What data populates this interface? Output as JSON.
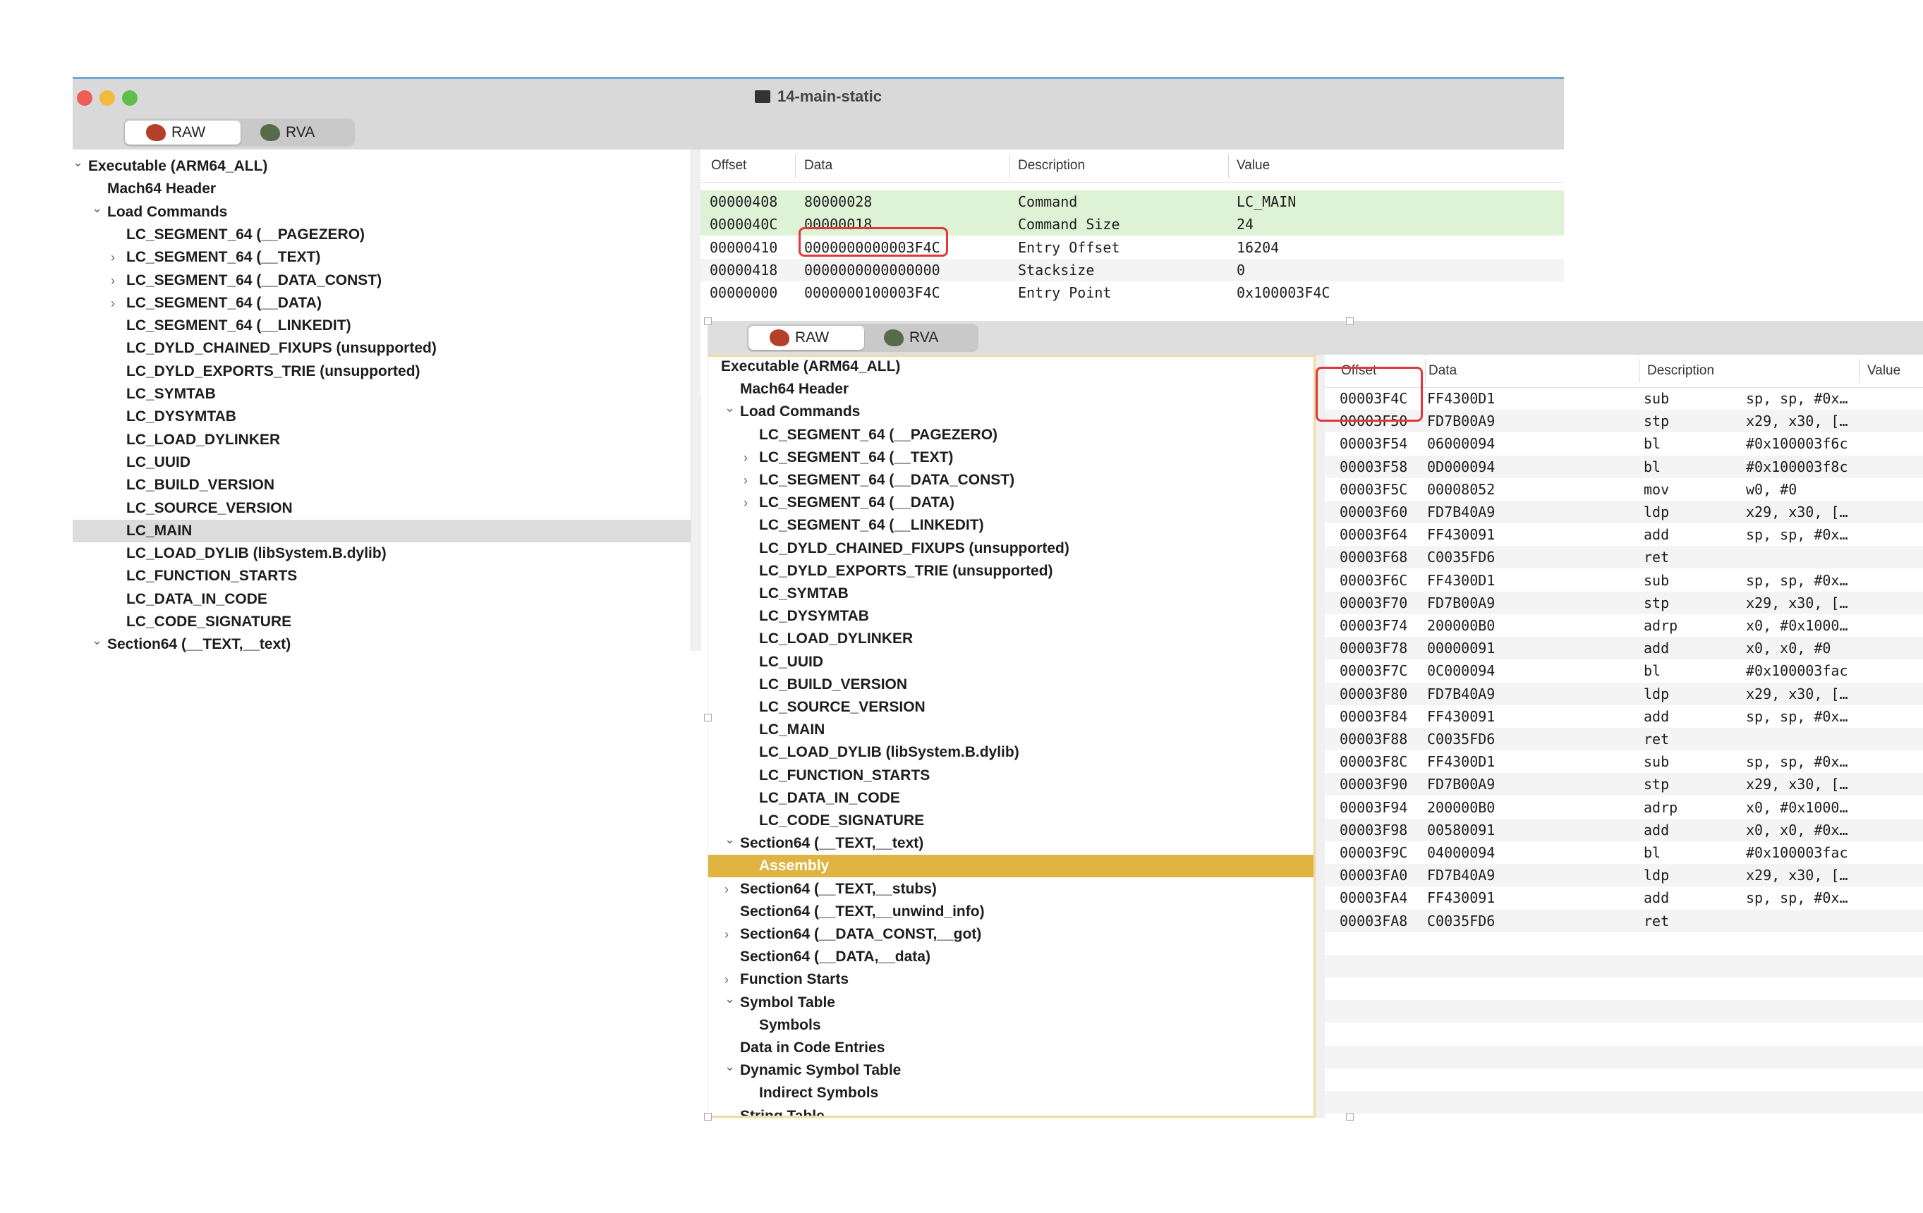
{
  "window1": {
    "title": "14-main-static",
    "toolbar": {
      "raw_label": "RAW",
      "rva_label": "RVA"
    },
    "tree": [
      {
        "label": "Executable  (ARM64_ALL)",
        "level": 0,
        "chevron": "down"
      },
      {
        "label": "Mach64 Header",
        "level": 1,
        "chevron": ""
      },
      {
        "label": "Load Commands",
        "level": 1,
        "chevron": "down"
      },
      {
        "label": "LC_SEGMENT_64 (__PAGEZERO)",
        "level": 2,
        "chevron": ""
      },
      {
        "label": "LC_SEGMENT_64 (__TEXT)",
        "level": 2,
        "chevron": "right"
      },
      {
        "label": "LC_SEGMENT_64 (__DATA_CONST)",
        "level": 2,
        "chevron": "right"
      },
      {
        "label": "LC_SEGMENT_64 (__DATA)",
        "level": 2,
        "chevron": "right"
      },
      {
        "label": "LC_SEGMENT_64 (__LINKEDIT)",
        "level": 2,
        "chevron": ""
      },
      {
        "label": "LC_DYLD_CHAINED_FIXUPS (unsupported)",
        "level": 2,
        "chevron": ""
      },
      {
        "label": "LC_DYLD_EXPORTS_TRIE (unsupported)",
        "level": 2,
        "chevron": ""
      },
      {
        "label": "LC_SYMTAB",
        "level": 2,
        "chevron": ""
      },
      {
        "label": "LC_DYSYMTAB",
        "level": 2,
        "chevron": ""
      },
      {
        "label": "LC_LOAD_DYLINKER",
        "level": 2,
        "chevron": ""
      },
      {
        "label": "LC_UUID",
        "level": 2,
        "chevron": ""
      },
      {
        "label": "LC_BUILD_VERSION",
        "level": 2,
        "chevron": ""
      },
      {
        "label": "LC_SOURCE_VERSION",
        "level": 2,
        "chevron": ""
      },
      {
        "label": "LC_MAIN",
        "level": 2,
        "chevron": "",
        "selected": true
      },
      {
        "label": "LC_LOAD_DYLIB (libSystem.B.dylib)",
        "level": 2,
        "chevron": ""
      },
      {
        "label": "LC_FUNCTION_STARTS",
        "level": 2,
        "chevron": ""
      },
      {
        "label": "LC_DATA_IN_CODE",
        "level": 2,
        "chevron": ""
      },
      {
        "label": "LC_CODE_SIGNATURE",
        "level": 2,
        "chevron": ""
      },
      {
        "label": "Section64 (__TEXT,__text)",
        "level": 1,
        "chevron": "down"
      }
    ],
    "table": {
      "columns": [
        "Offset",
        "Data",
        "Description",
        "Value"
      ],
      "rows": [
        {
          "offset": "00000408",
          "data": "80000028",
          "description": "Command",
          "value": "LC_MAIN",
          "style": "green"
        },
        {
          "offset": "0000040C",
          "data": "00000018",
          "description": "Command Size",
          "value": "24",
          "style": "green"
        },
        {
          "offset": "00000410",
          "data": "0000000000003F4C",
          "description": "Entry Offset",
          "value": "16204",
          "style": ""
        },
        {
          "offset": "00000418",
          "data": "0000000000000000",
          "description": "Stacksize",
          "value": "0",
          "style": "alt"
        },
        {
          "offset": "00000000",
          "data": "0000000100003F4C",
          "description": "Entry Point",
          "value": "0x100003F4C",
          "style": ""
        }
      ]
    }
  },
  "window2": {
    "toolbar": {
      "raw_label": "RAW",
      "rva_label": "RVA"
    },
    "tree": [
      {
        "label": "Executable  (ARM64_ALL)",
        "level": 0,
        "chevron": ""
      },
      {
        "label": "Mach64 Header",
        "level": 1,
        "chevron": ""
      },
      {
        "label": "Load Commands",
        "level": 1,
        "chevron": "down"
      },
      {
        "label": "LC_SEGMENT_64 (__PAGEZERO)",
        "level": 2,
        "chevron": ""
      },
      {
        "label": "LC_SEGMENT_64 (__TEXT)",
        "level": 2,
        "chevron": "right"
      },
      {
        "label": "LC_SEGMENT_64 (__DATA_CONST)",
        "level": 2,
        "chevron": "right"
      },
      {
        "label": "LC_SEGMENT_64 (__DATA)",
        "level": 2,
        "chevron": "right"
      },
      {
        "label": "LC_SEGMENT_64 (__LINKEDIT)",
        "level": 2,
        "chevron": ""
      },
      {
        "label": "LC_DYLD_CHAINED_FIXUPS (unsupported)",
        "level": 2,
        "chevron": ""
      },
      {
        "label": "LC_DYLD_EXPORTS_TRIE (unsupported)",
        "level": 2,
        "chevron": ""
      },
      {
        "label": "LC_SYMTAB",
        "level": 2,
        "chevron": ""
      },
      {
        "label": "LC_DYSYMTAB",
        "level": 2,
        "chevron": ""
      },
      {
        "label": "LC_LOAD_DYLINKER",
        "level": 2,
        "chevron": ""
      },
      {
        "label": "LC_UUID",
        "level": 2,
        "chevron": ""
      },
      {
        "label": "LC_BUILD_VERSION",
        "level": 2,
        "chevron": ""
      },
      {
        "label": "LC_SOURCE_VERSION",
        "level": 2,
        "chevron": ""
      },
      {
        "label": "LC_MAIN",
        "level": 2,
        "chevron": ""
      },
      {
        "label": "LC_LOAD_DYLIB (libSystem.B.dylib)",
        "level": 2,
        "chevron": ""
      },
      {
        "label": "LC_FUNCTION_STARTS",
        "level": 2,
        "chevron": ""
      },
      {
        "label": "LC_DATA_IN_CODE",
        "level": 2,
        "chevron": ""
      },
      {
        "label": "LC_CODE_SIGNATURE",
        "level": 2,
        "chevron": ""
      },
      {
        "label": "Section64 (__TEXT,__text)",
        "level": 1,
        "chevron": "down"
      },
      {
        "label": "Assembly",
        "level": 2,
        "chevron": "",
        "selected": true
      },
      {
        "label": "Section64 (__TEXT,__stubs)",
        "level": 1,
        "chevron": "right"
      },
      {
        "label": "Section64 (__TEXT,__unwind_info)",
        "level": 1,
        "chevron": ""
      },
      {
        "label": "Section64 (__DATA_CONST,__got)",
        "level": 1,
        "chevron": "right"
      },
      {
        "label": "Section64 (__DATA,__data)",
        "level": 1,
        "chevron": ""
      },
      {
        "label": "Function Starts",
        "level": 1,
        "chevron": "right"
      },
      {
        "label": "Symbol Table",
        "level": 1,
        "chevron": "down"
      },
      {
        "label": "Symbols",
        "level": 2,
        "chevron": ""
      },
      {
        "label": "Data in Code Entries",
        "level": 1,
        "chevron": ""
      },
      {
        "label": "Dynamic Symbol Table",
        "level": 1,
        "chevron": "down"
      },
      {
        "label": "Indirect Symbols",
        "level": 2,
        "chevron": ""
      },
      {
        "label": "String Table",
        "level": 1,
        "chevron": ""
      }
    ],
    "table": {
      "columns": [
        "Offset",
        "Data",
        "Description",
        "Value"
      ],
      "rows": [
        {
          "offset": "00003F4C",
          "data": "FF4300D1",
          "mnemonic": "sub",
          "operands": "sp, sp, #0x…"
        },
        {
          "offset": "00003F50",
          "data": "FD7B00A9",
          "mnemonic": "stp",
          "operands": "x29, x30, […"
        },
        {
          "offset": "00003F54",
          "data": "06000094",
          "mnemonic": "bl",
          "operands": "#0x100003f6c"
        },
        {
          "offset": "00003F58",
          "data": "0D000094",
          "mnemonic": "bl",
          "operands": "#0x100003f8c"
        },
        {
          "offset": "00003F5C",
          "data": "00008052",
          "mnemonic": "mov",
          "operands": "w0, #0"
        },
        {
          "offset": "00003F60",
          "data": "FD7B40A9",
          "mnemonic": "ldp",
          "operands": "x29, x30, […"
        },
        {
          "offset": "00003F64",
          "data": "FF430091",
          "mnemonic": "add",
          "operands": "sp, sp, #0x…"
        },
        {
          "offset": "00003F68",
          "data": "C0035FD6",
          "mnemonic": "ret",
          "operands": ""
        },
        {
          "offset": "00003F6C",
          "data": "FF4300D1",
          "mnemonic": "sub",
          "operands": "sp, sp, #0x…"
        },
        {
          "offset": "00003F70",
          "data": "FD7B00A9",
          "mnemonic": "stp",
          "operands": "x29, x30, […"
        },
        {
          "offset": "00003F74",
          "data": "200000B0",
          "mnemonic": "adrp",
          "operands": "x0, #0x1000…"
        },
        {
          "offset": "00003F78",
          "data": "00000091",
          "mnemonic": "add",
          "operands": "x0, x0, #0"
        },
        {
          "offset": "00003F7C",
          "data": "0C000094",
          "mnemonic": "bl",
          "operands": "#0x100003fac"
        },
        {
          "offset": "00003F80",
          "data": "FD7B40A9",
          "mnemonic": "ldp",
          "operands": "x29, x30, […"
        },
        {
          "offset": "00003F84",
          "data": "FF430091",
          "mnemonic": "add",
          "operands": "sp, sp, #0x…"
        },
        {
          "offset": "00003F88",
          "data": "C0035FD6",
          "mnemonic": "ret",
          "operands": ""
        },
        {
          "offset": "00003F8C",
          "data": "FF4300D1",
          "mnemonic": "sub",
          "operands": "sp, sp, #0x…"
        },
        {
          "offset": "00003F90",
          "data": "FD7B00A9",
          "mnemonic": "stp",
          "operands": "x29, x30, […"
        },
        {
          "offset": "00003F94",
          "data": "200000B0",
          "mnemonic": "adrp",
          "operands": "x0, #0x1000…"
        },
        {
          "offset": "00003F98",
          "data": "00580091",
          "mnemonic": "add",
          "operands": "x0, x0, #0x…"
        },
        {
          "offset": "00003F9C",
          "data": "04000094",
          "mnemonic": "bl",
          "operands": "#0x100003fac"
        },
        {
          "offset": "00003FA0",
          "data": "FD7B40A9",
          "mnemonic": "ldp",
          "operands": "x29, x30, […"
        },
        {
          "offset": "00003FA4",
          "data": "FF430091",
          "mnemonic": "add",
          "operands": "sp, sp, #0x…"
        },
        {
          "offset": "00003FA8",
          "data": "C0035FD6",
          "mnemonic": "ret",
          "operands": ""
        }
      ]
    }
  },
  "icons": {
    "document": "document-icon",
    "raw": "raw-mode-icon",
    "rva": "rva-mode-icon"
  },
  "colors": {
    "close": "#ee5e56",
    "minimize": "#f2bb3c",
    "zoom": "#5ec04a",
    "selection_accent": "#e0b441",
    "highlight_green": "#def2d6",
    "callout_red": "#e2373b"
  }
}
